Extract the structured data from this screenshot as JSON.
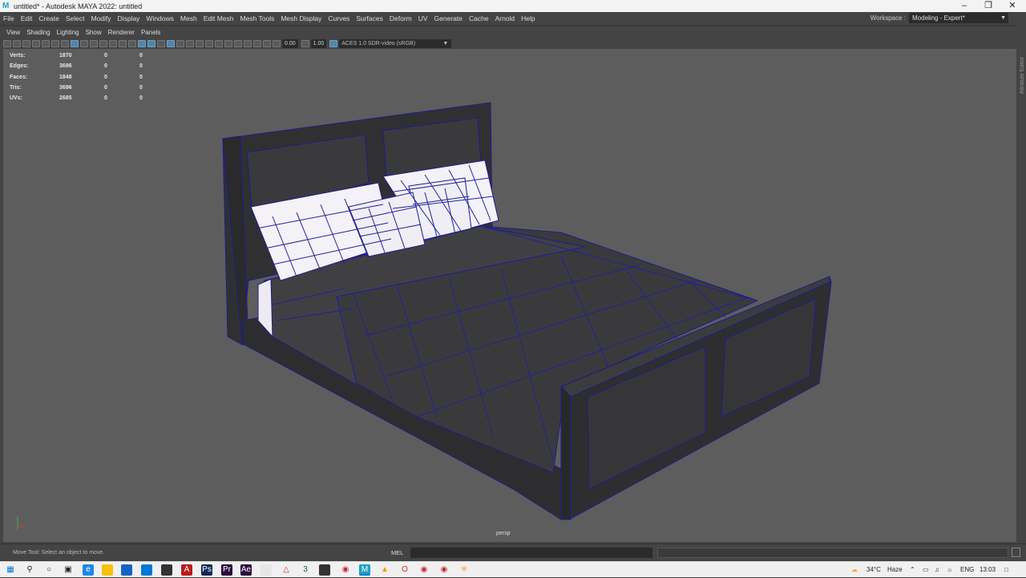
{
  "window": {
    "title": "untitled* - Autodesk MAYA 2022: untitled",
    "app_icon": "maya-icon",
    "controls": [
      "minimize-icon",
      "restore-icon",
      "close-icon"
    ]
  },
  "menubar": {
    "items": [
      "File",
      "Edit",
      "Create",
      "Select",
      "Modify",
      "Display",
      "Windows",
      "Mesh",
      "Edit Mesh",
      "Mesh Tools",
      "Mesh Display",
      "Curves",
      "Surfaces",
      "Deform",
      "UV",
      "Generate",
      "Cache",
      "Arnold",
      "Help"
    ]
  },
  "workspace": {
    "label": "Workspace :",
    "value": "Modeling - Expert*"
  },
  "attribute_editor": {
    "label": "Attribute Editor"
  },
  "panel": {
    "menu": [
      "View",
      "Shading",
      "Lighting",
      "Show",
      "Renderer",
      "Panels"
    ],
    "toolbar": {
      "exposure": "0.00",
      "gamma": "1.00",
      "color_management": "ACES 1.0 SDR-video (sRGB)"
    }
  },
  "hud": {
    "rows": [
      {
        "label": "Verts:",
        "values": [
          "1870",
          "0",
          "0"
        ]
      },
      {
        "label": "Edges:",
        "values": [
          "3696",
          "0",
          "0"
        ]
      },
      {
        "label": "Faces:",
        "values": [
          "1848",
          "0",
          "0"
        ]
      },
      {
        "label": "Tris:",
        "values": [
          "3696",
          "0",
          "0"
        ]
      },
      {
        "label": "UVs:",
        "values": [
          "2685",
          "0",
          "0"
        ]
      }
    ]
  },
  "viewport": {
    "camera": "persp",
    "background": "#5d5d5d",
    "wire_color": "#2020a0",
    "mesh_color": "#3a3a3c",
    "pillow_color": "#f4f2f7"
  },
  "statusbar": {
    "message": "Move Tool: Select an object to move.",
    "mel_label": "MEL"
  },
  "taskbar": {
    "weather": "34°C",
    "weather_text": "Haze",
    "lang": "ENG",
    "time": "13:03"
  }
}
